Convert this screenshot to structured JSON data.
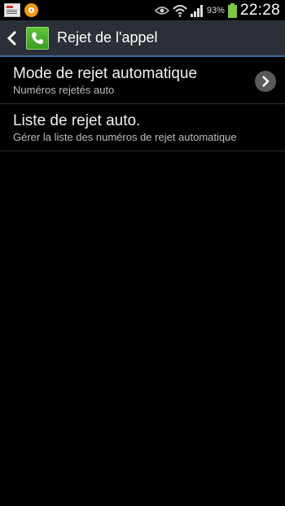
{
  "status_bar": {
    "battery_percent": "93%",
    "time": "22:28",
    "notification_icons": [
      "news-notification-icon",
      "orange-app-notification-icon"
    ],
    "system_icons": [
      "eye-icon",
      "wifi-icon",
      "signal-icon",
      "battery-icon"
    ]
  },
  "action_bar": {
    "title": "Rejet de l'appel",
    "back_icon": "chevron-left-icon",
    "app_icon": "phone-icon",
    "accent_color": "#3a6ea0"
  },
  "settings": [
    {
      "title": "Mode de rejet automatique",
      "subtitle": "Numéros rejetés auto",
      "has_chevron": true
    },
    {
      "title": "Liste de rejet auto.",
      "subtitle": "Gérer la liste des numéros de rejet automatique",
      "has_chevron": false
    }
  ]
}
